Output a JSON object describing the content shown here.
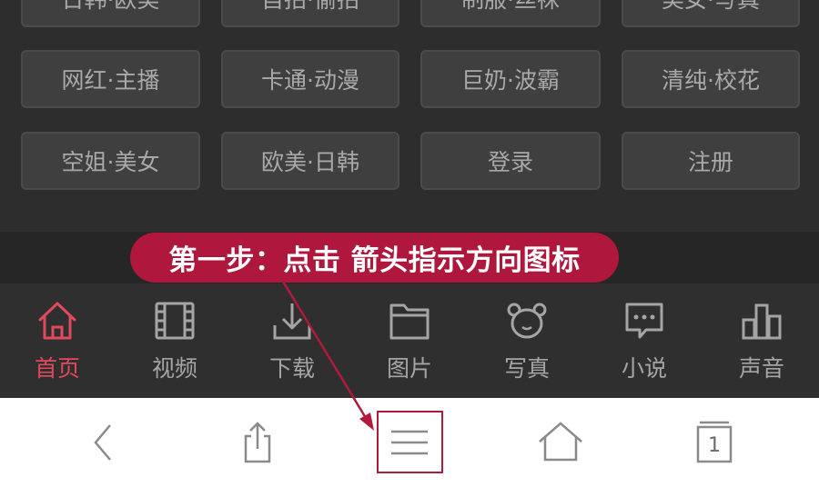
{
  "categories": [
    {
      "label": "日韩·欧美"
    },
    {
      "label": "自拍·偷拍"
    },
    {
      "label": "制服·丝袜"
    },
    {
      "label": "美女·写真"
    },
    {
      "label": "网红·主播"
    },
    {
      "label": "卡通·动漫"
    },
    {
      "label": "巨奶·波霸"
    },
    {
      "label": "清纯·校花"
    },
    {
      "label": "空姐·美女"
    },
    {
      "label": "欧美·日韩"
    },
    {
      "label": "登录"
    },
    {
      "label": "注册"
    }
  ],
  "callout": {
    "text": "第一步：点击 箭头指示方向图标"
  },
  "bottom_nav": [
    {
      "label": "首页",
      "icon": "home-icon",
      "active": true
    },
    {
      "label": "视频",
      "icon": "film-icon"
    },
    {
      "label": "下载",
      "icon": "download-icon"
    },
    {
      "label": "图片",
      "icon": "folder-icon"
    },
    {
      "label": "写真",
      "icon": "bear-icon"
    },
    {
      "label": "小说",
      "icon": "chat-icon"
    },
    {
      "label": "声音",
      "icon": "bar-chart-icon"
    }
  ],
  "browser_toolbar": {
    "items": [
      "back-icon",
      "share-icon",
      "menu-icon",
      "home-icon",
      "tabs-icon"
    ],
    "tab_count": "1"
  },
  "colors": {
    "accent": "#e2495c",
    "callout_bg": "#b0173c",
    "highlight_border": "#b01b3b"
  }
}
